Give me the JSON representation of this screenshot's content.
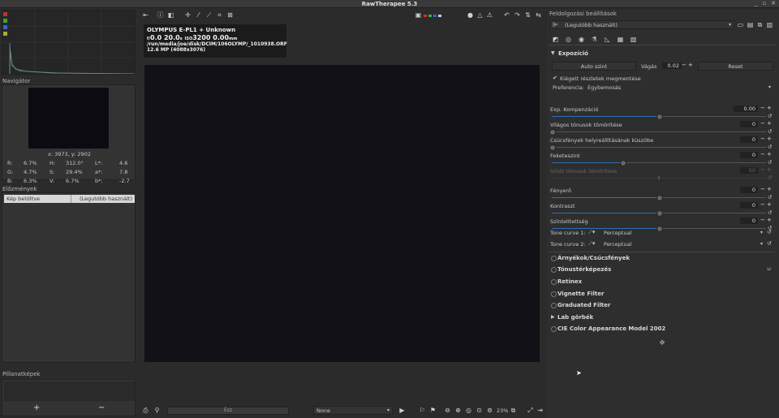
{
  "app": {
    "title": "RawTherapee 5.3"
  },
  "navigator": {
    "title": "Navigátor",
    "coords": "x: 3973, y: 2902",
    "readout": [
      [
        "R:",
        "6.7%",
        "H:",
        "312.0°",
        "L*:",
        "4.6"
      ],
      [
        "G:",
        "4.7%",
        "S:",
        "29.4%",
        "a*:",
        "7.8"
      ],
      [
        "B:",
        "6.3%",
        "V:",
        "6.7%",
        "b*:",
        "-2.7"
      ]
    ]
  },
  "history": {
    "title": "Előzmények",
    "col1": "Kép betöltve",
    "col2": "(Legutóbb használt)"
  },
  "snapshots": {
    "title": "Pillanatképek",
    "add": "+",
    "remove": "−"
  },
  "info": {
    "camera": "OLYMPUS E-PL1 + Unknown",
    "exposure_parts": [
      "f/",
      "0.0",
      "20.0",
      "s",
      "ISO",
      "3200",
      "0.00",
      "mm"
    ],
    "path": "/run/media/joe/disk/DCIM/106OLYMP/_1010938.ORF",
    "size": "12.6 MP (4088x3076)"
  },
  "bottom": {
    "size_label": "Ész",
    "profile_select": "None",
    "zoom": "23%"
  },
  "right": {
    "title": "Feldolgozási beállítások",
    "profile": "(Legutóbb használt)",
    "exposure": {
      "title": "Expozíció",
      "auto_label": "Auto szint",
      "clip_label": "Vágás",
      "clip_value": "0.02",
      "reset_label": "Reset",
      "highlight_recon": "Kiégett részletek megmentése",
      "method_label": "Preferencia:",
      "method_value": "Egybemosás",
      "sliders": [
        {
          "label": "Exp. Kompenzáció",
          "value": "0.00",
          "level": 0.5
        },
        {
          "label": "Világos tónusok tömörítése",
          "value": "0",
          "level": 0.0
        },
        {
          "label": "Csúcsfények helyreállításának küszöbe",
          "value": "0",
          "level": 0.0
        },
        {
          "label": "Feketeszint",
          "value": "0",
          "level": 0.33
        },
        {
          "label": "Sötét tónusok tömörítése",
          "value": "50",
          "level": 0.5
        },
        {
          "label": "Fényerő",
          "value": "0",
          "level": 0.5
        },
        {
          "label": "Kontraszt",
          "value": "0",
          "level": 0.5
        },
        {
          "label": "Színtelítettség",
          "value": "0",
          "level": 0.5
        }
      ],
      "tone1_label": "Tone curve 1:",
      "tone1_value": "Perceptual",
      "tone2_label": "Tone curve 2:",
      "tone2_value": "Perceptual"
    },
    "sections": [
      "Árnyékok/Csúcsfények",
      "Tónustérképezés",
      "Retinex",
      "Vignette Filter",
      "Graduated Filter",
      "Lab görbék",
      "CIE Color Appearance Model 2002"
    ]
  },
  "colors": {
    "accent": "#2d6fb5",
    "bg": "#2b2b2b",
    "canvas": "#111117"
  }
}
